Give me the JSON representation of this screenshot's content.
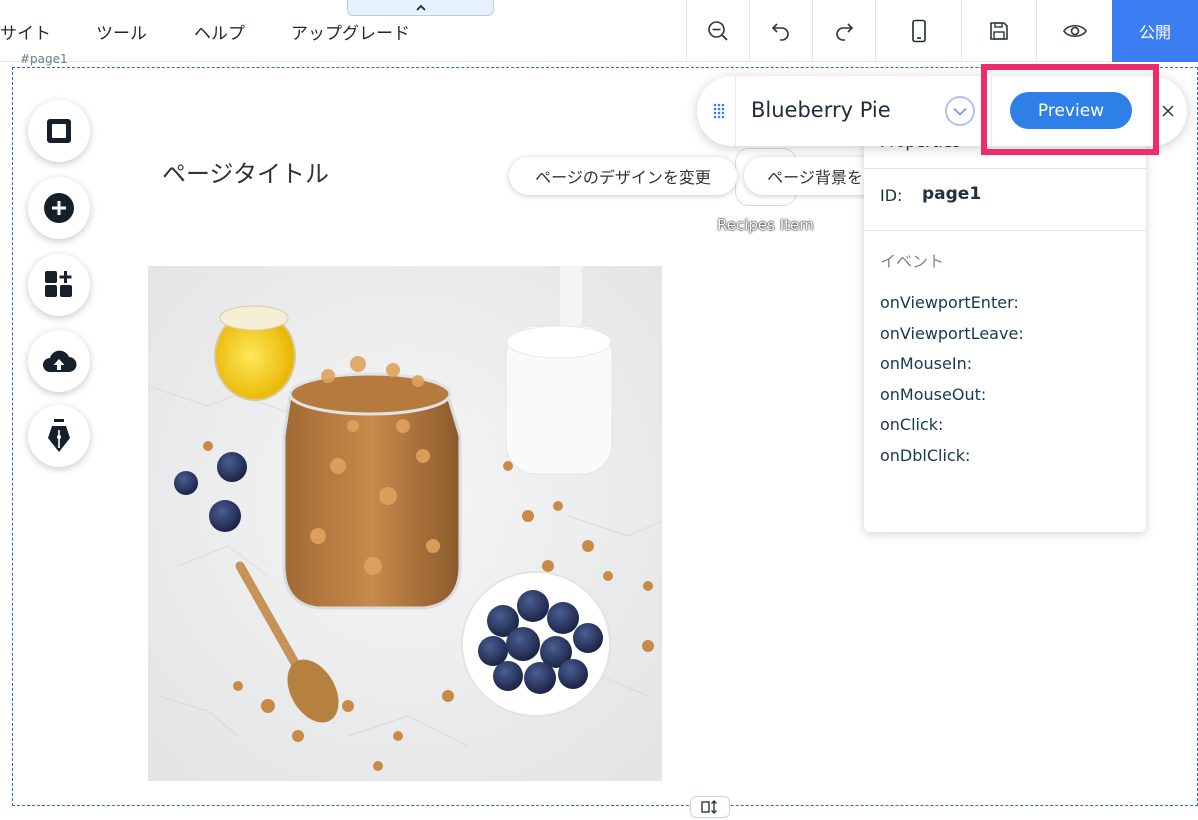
{
  "menu": {
    "site": "サイト",
    "tools": "ツール",
    "help": "ヘルプ",
    "upgrade": "アップグレード"
  },
  "toolbar": {
    "publish": "公開"
  },
  "canvas": {
    "page_label": "#page1",
    "page_title": "ページタイトル",
    "change_design": "ページのデザインを変更",
    "change_background": "ページ背景を変更",
    "recipes_label": "Recipes Item"
  },
  "properties": {
    "title": "Properties",
    "id_label": "ID:",
    "id_value": "page1",
    "events_heading": "イベント",
    "events": [
      "onViewportEnter:",
      "onViewportLeave:",
      "onMouseIn:",
      "onMouseOut:",
      "onClick:",
      "onDblClick:"
    ]
  },
  "page_bar": {
    "name": "Blueberry Pie",
    "preview": "Preview"
  },
  "colors": {
    "accent": "#3b7ef1",
    "highlight": "#ef2c6a",
    "frame": "#2b6cd1"
  }
}
